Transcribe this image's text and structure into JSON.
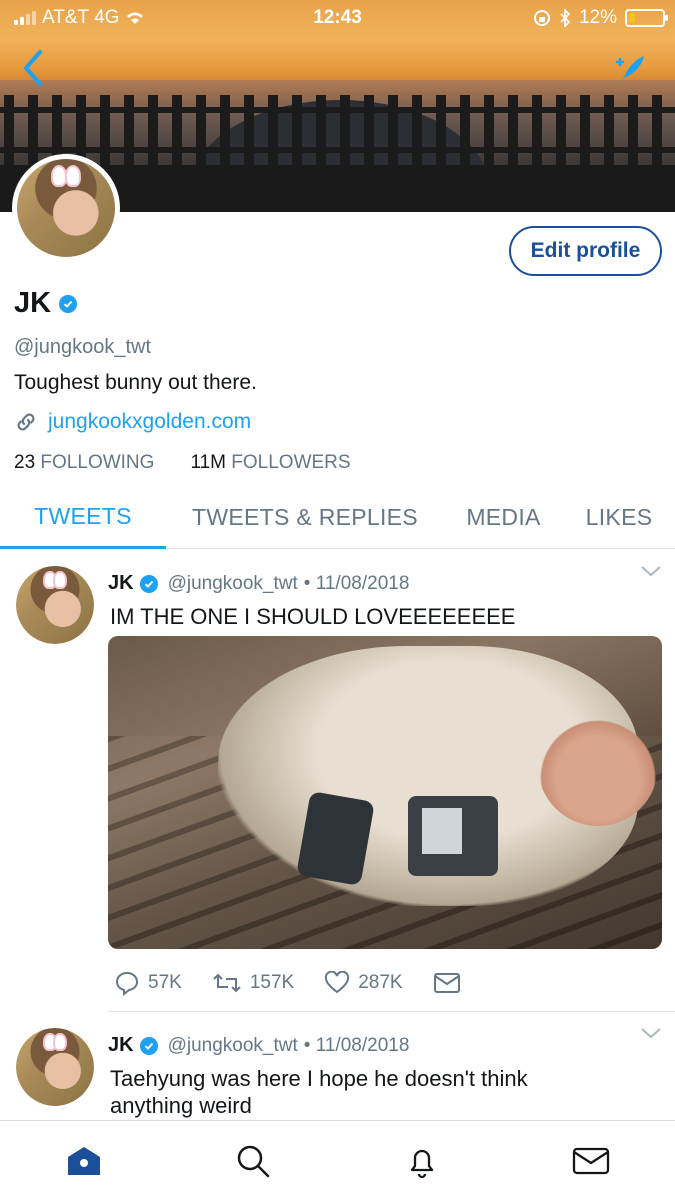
{
  "status_bar": {
    "carrier": "AT&T 4G",
    "time": "12:43",
    "battery": "12%"
  },
  "profile": {
    "edit_label": "Edit profile",
    "name": "JK",
    "handle": "@jungkook_twt",
    "bio": "Toughest bunny out there.",
    "link": "jungkookxgolden.com",
    "following_count": "23",
    "following_label": "FOLLOWING",
    "followers_count": "11M",
    "followers_label": "FOLLOWERS"
  },
  "tabs": [
    {
      "label": "TWEETS",
      "active": true
    },
    {
      "label": "TWEETS & REPLIES",
      "active": false
    },
    {
      "label": "MEDIA",
      "active": false
    },
    {
      "label": "LIKES",
      "active": false
    }
  ],
  "tweets": [
    {
      "name": "JK",
      "handle": "@jungkook_twt",
      "date": "• 11/08/2018",
      "text": "IM THE ONE I SHOULD LOVEEEEEEEE",
      "replies": "57K",
      "retweets": "157K",
      "likes": "287K"
    },
    {
      "name": "JK",
      "handle": "@jungkook_twt",
      "date": "• 11/08/2018",
      "text": "Taehyung was here I hope he doesn't think anything weird"
    }
  ],
  "colors": {
    "accent": "#1da1f2",
    "edit_border": "#1b4f9a",
    "secondary_text": "#657786"
  },
  "icons": [
    "back-arrow-icon",
    "compose-icon",
    "verified-icon",
    "link-icon",
    "reply-icon",
    "retweet-icon",
    "like-icon",
    "message-icon",
    "home-icon",
    "search-icon",
    "notifications-icon",
    "messages-icon",
    "chevron-down-icon"
  ]
}
